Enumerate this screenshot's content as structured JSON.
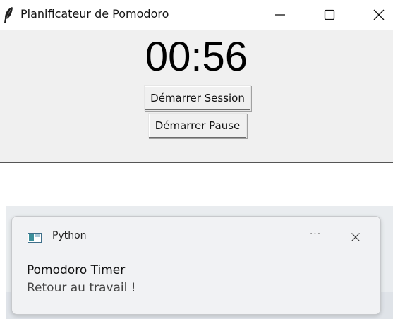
{
  "window": {
    "title": "Planificateur de Pomodoro",
    "icon": "feather-icon",
    "controls": [
      "minimize-icon",
      "maximize-icon",
      "close-icon"
    ]
  },
  "timer": {
    "display": "00:56"
  },
  "buttons": {
    "start_session": "Démarrer Session",
    "start_pause": "Démarrer Pause"
  },
  "notification": {
    "app_name": "Python",
    "app_icon": "python-app-icon",
    "more_label": "···",
    "title": "Pomodoro Timer",
    "message": "Retour au travail !"
  },
  "colors": {
    "window_bg": "#f0f0f0",
    "titlebar_bg": "#ffffff",
    "toast_bg": "#f1f2f4",
    "toast_border": "#c7c9cc"
  }
}
